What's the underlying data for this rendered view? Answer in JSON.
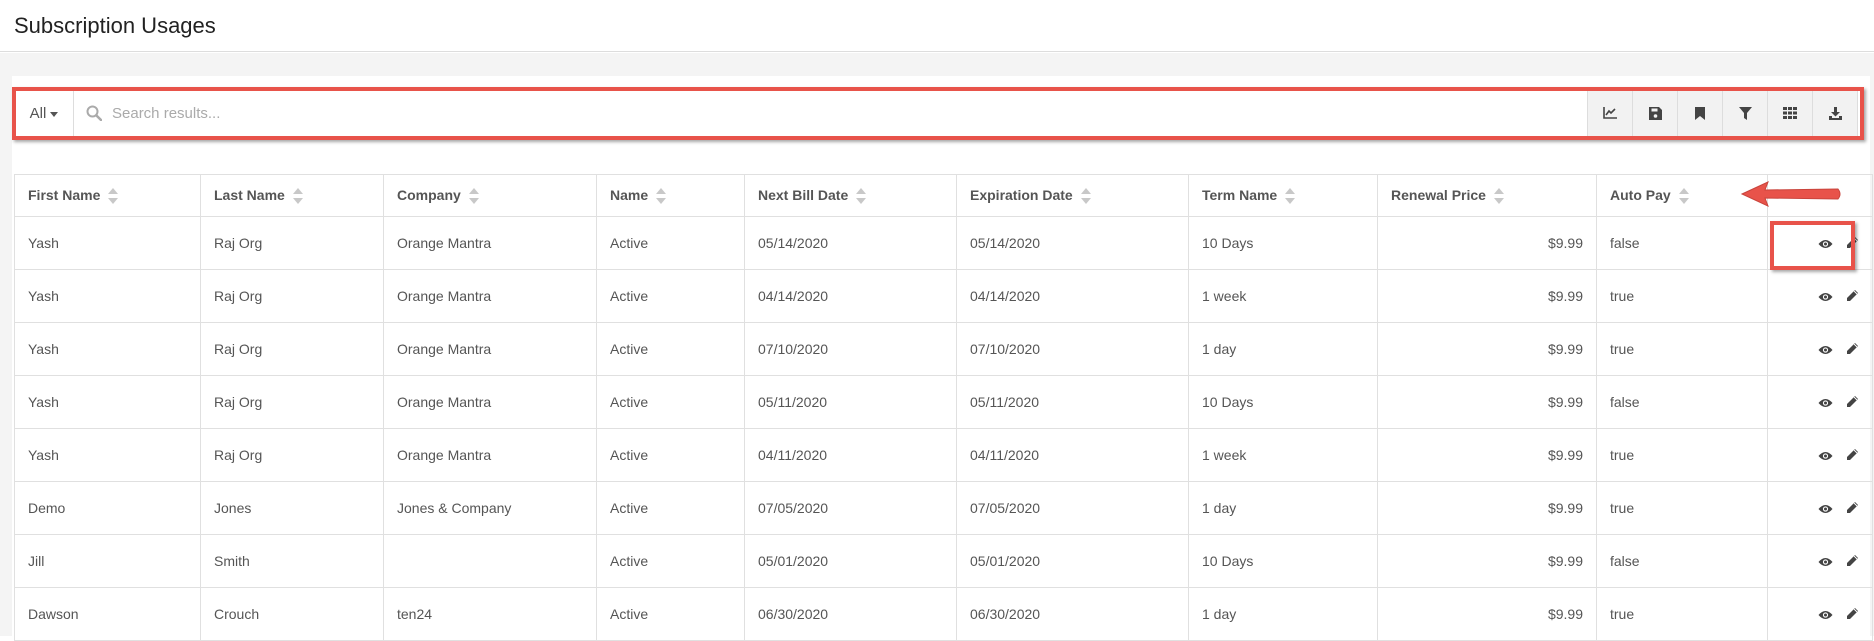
{
  "page": {
    "title": "Subscription Usages"
  },
  "toolbar": {
    "filter_label": "All",
    "search_placeholder": "Search results...",
    "buttons": [
      "chart-icon",
      "save-icon",
      "bookmark-icon",
      "filter-icon",
      "grid-icon",
      "download-icon"
    ]
  },
  "colors": {
    "annotation": "#e8534a"
  },
  "table": {
    "columns": [
      "First Name",
      "Last Name",
      "Company",
      "Name",
      "Next Bill Date",
      "Expiration Date",
      "Term Name",
      "Renewal Price",
      "Auto Pay"
    ],
    "rows": [
      [
        "Yash",
        "Raj Org",
        "Orange Mantra",
        "Active",
        "05/14/2020",
        "05/14/2020",
        "10 Days",
        "$9.99",
        "false"
      ],
      [
        "Yash",
        "Raj Org",
        "Orange Mantra",
        "Active",
        "04/14/2020",
        "04/14/2020",
        "1 week",
        "$9.99",
        "true"
      ],
      [
        "Yash",
        "Raj Org",
        "Orange Mantra",
        "Active",
        "07/10/2020",
        "07/10/2020",
        "1 day",
        "$9.99",
        "true"
      ],
      [
        "Yash",
        "Raj Org",
        "Orange Mantra",
        "Active",
        "05/11/2020",
        "05/11/2020",
        "10 Days",
        "$9.99",
        "false"
      ],
      [
        "Yash",
        "Raj Org",
        "Orange Mantra",
        "Active",
        "04/11/2020",
        "04/11/2020",
        "1 week",
        "$9.99",
        "true"
      ],
      [
        "Demo",
        "Jones",
        "Jones & Company",
        "Active",
        "07/05/2020",
        "07/05/2020",
        "1 day",
        "$9.99",
        "true"
      ],
      [
        "Jill",
        "Smith",
        "",
        "Active",
        "05/01/2020",
        "05/01/2020",
        "10 Days",
        "$9.99",
        "false"
      ],
      [
        "Dawson",
        "Crouch",
        "ten24",
        "Active",
        "06/30/2020",
        "06/30/2020",
        "1 day",
        "$9.99",
        "true"
      ]
    ]
  }
}
